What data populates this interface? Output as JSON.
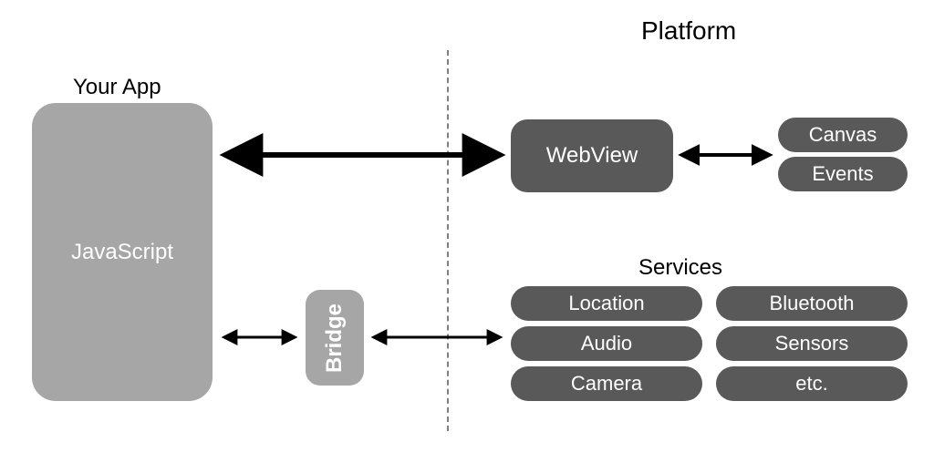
{
  "headings": {
    "yourApp": "Your App",
    "platform": "Platform",
    "services": "Services"
  },
  "nodes": {
    "javascript": "JavaScript",
    "bridge": "Bridge",
    "webview": "WebView"
  },
  "webviewPills": {
    "canvas": "Canvas",
    "events": "Events"
  },
  "servicePills": {
    "location": "Location",
    "audio": "Audio",
    "camera": "Camera",
    "bluetooth": "Bluetooth",
    "sensors": "Sensors",
    "etc": "etc."
  }
}
